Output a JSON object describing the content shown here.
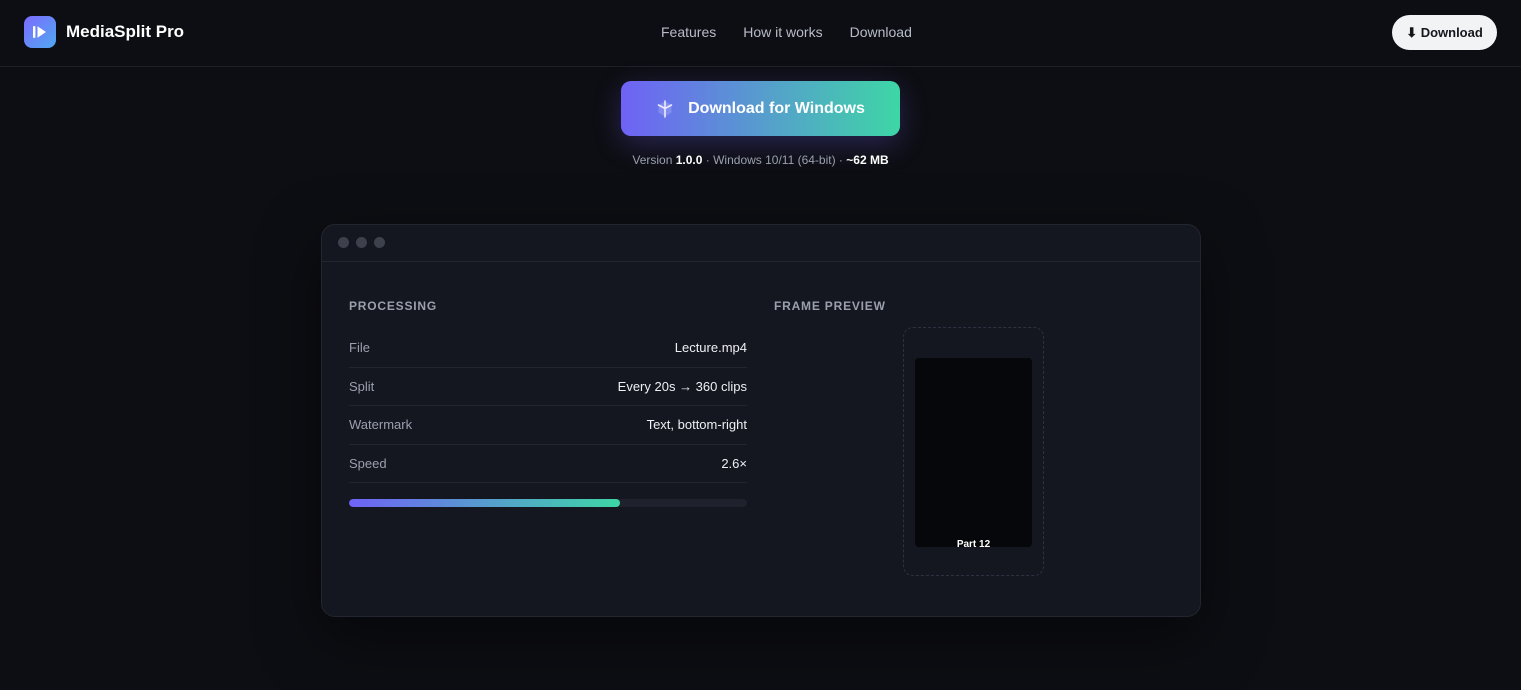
{
  "app": {
    "name": "MediaSplit Pro"
  },
  "nav": {
    "links": [
      "Features",
      "How it works",
      "Download"
    ],
    "download_button": "⬇ Download"
  },
  "hero": {
    "cta_label": "Download for Windows",
    "meta": {
      "version_label": "Version ",
      "version": "1.0.0",
      "platform": " · Windows 10/11 (64-bit) · ",
      "size": "~62 MB"
    }
  },
  "processing": {
    "title": "PROCESSING",
    "rows": [
      {
        "label": "File",
        "value": "Lecture.mp4"
      },
      {
        "label": "Split",
        "value": "Every 20s → 360 clips"
      },
      {
        "label": "Watermark",
        "value": "Text, bottom-right"
      },
      {
        "label": "Speed",
        "value": "2.6×"
      }
    ],
    "progress_fraction": 0.68
  },
  "preview": {
    "title": "FRAME PREVIEW",
    "label": "Part 12"
  },
  "colors": {
    "background": "#0d0e13",
    "accent_start": "#6f62f6",
    "accent_end": "#3ed6a6"
  },
  "icons": {
    "logo": "play-icon",
    "cta": "windows-icon"
  }
}
